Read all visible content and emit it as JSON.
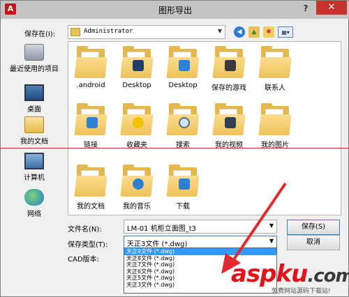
{
  "window": {
    "title": "图形导出",
    "help": "?",
    "close": "✕",
    "app_icon": "A"
  },
  "toolbar": {
    "save_in_label": "保存在(I):",
    "save_in_value": "Administrator",
    "icons": [
      "back-icon",
      "up-folder-icon",
      "new-folder-icon",
      "view-menu-icon"
    ]
  },
  "places": [
    {
      "label": "最近使用的项目",
      "icon": "recent-items-icon"
    },
    {
      "label": "桌面",
      "icon": "desktop-icon"
    },
    {
      "label": "我的文档",
      "icon": "documents-icon"
    },
    {
      "label": "计算机",
      "icon": "computer-icon"
    },
    {
      "label": "网络",
      "icon": "network-icon"
    }
  ],
  "files": [
    {
      "name": ".android",
      "icon": "folder-icon"
    },
    {
      "name": "Desktop",
      "icon": "folder-icon"
    },
    {
      "name": "Desktop",
      "icon": "folder-icon"
    },
    {
      "name": "保存的游戏",
      "icon": "folder-icon"
    },
    {
      "name": "联系人",
      "icon": "folder-icon"
    },
    {
      "name": "链接",
      "icon": "folder-icon"
    },
    {
      "name": "收藏夹",
      "icon": "folder-icon"
    },
    {
      "name": "搜索",
      "icon": "folder-icon"
    },
    {
      "name": "我的视频",
      "icon": "folder-icon"
    },
    {
      "name": "我的图片",
      "icon": "folder-icon"
    },
    {
      "name": "我的文档",
      "icon": "folder-icon"
    },
    {
      "name": "我的音乐",
      "icon": "folder-icon"
    },
    {
      "name": "下载",
      "icon": "folder-icon"
    }
  ],
  "form": {
    "filename_label": "文件名(N):",
    "filename_value": "LM-01 机柜立面图_t3",
    "type_label": "保存类型(T):",
    "type_value": "天正3文件 (*.dwg)",
    "cad_label": "CAD版本:",
    "save_button": "保存(S)",
    "cancel_button": "取消"
  },
  "dropdown_options": [
    "天正9文件 (*.dwg)",
    "天正8文件 (*.dwg)",
    "天正7文件 (*.dwg)",
    "天正6文件 (*.dwg)",
    "天正5文件 (*.dwg)",
    "天正3文件 (*.dwg)"
  ],
  "watermark": {
    "text_a": "asp",
    "text_b": "ku",
    "text_c": ".com",
    "sub": "免费网站源码下载站!"
  },
  "colors": {
    "selection": "#3399ff",
    "annotation": "#e32a2a",
    "close": "#c7312c"
  }
}
